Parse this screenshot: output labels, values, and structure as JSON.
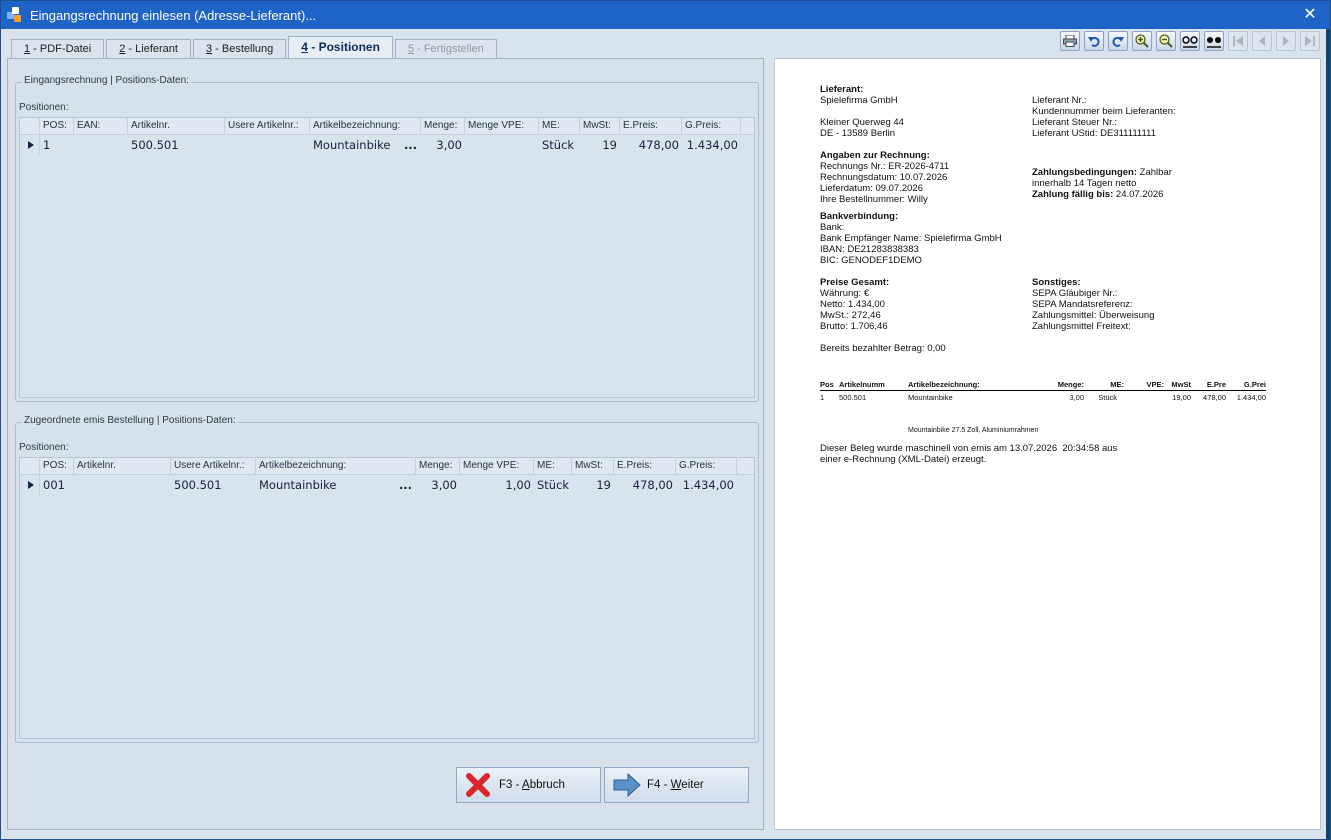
{
  "window": {
    "title": "Eingangsrechnung einlesen (Adresse-Lieferant)...",
    "close_glyph": "✕"
  },
  "tabs": [
    {
      "num": "1",
      "label": " - PDF-Datei"
    },
    {
      "num": "2",
      "label": " - Lieferant"
    },
    {
      "num": "3",
      "label": " - Bestellung"
    },
    {
      "num": "4",
      "label": " - Positionen"
    },
    {
      "num": "5",
      "label": " - Fertigstellen"
    }
  ],
  "toolbar": {
    "icons": [
      "printer-icon",
      "undo-icon",
      "redo-icon",
      "zoom-in-icon",
      "zoom-out-icon",
      "fit-width-icon",
      "fit-page-icon",
      "first-page-icon",
      "prev-page-icon",
      "next-page-icon",
      "last-page-icon"
    ]
  },
  "invoice_group": {
    "legend": "Eingangsrechnung | Positions-Daten:",
    "sublabel": "Positionen:",
    "headers": [
      "POS:",
      "EAN:",
      "Artikelnr.",
      "Usere Artikelnr.:",
      "Artikelbezeichnung:",
      "Menge:",
      "Menge VPE:",
      "ME:",
      "MwSt:",
      "E.Preis:",
      "G.Preis:"
    ],
    "rows": [
      {
        "pos": "1",
        "ean": "",
        "artikelnr": "500.501",
        "user_artikelnr": "",
        "bezeichnung": "Mountainbike",
        "dots": "...",
        "menge": "3,00",
        "menge_vpe": "",
        "me": "Stück",
        "mwst": "19",
        "epreis": "478,00",
        "gpreis": "1.434,00"
      }
    ]
  },
  "order_group": {
    "legend": "Zugeordnete emis Bestellung | Positions-Daten:",
    "sublabel": "Positionen:",
    "headers": [
      "POS:",
      "Artikelnr.",
      "Usere Artikelnr.:",
      "Artikelbezeichnung:",
      "Menge:",
      "Menge VPE:",
      "ME:",
      "MwSt:",
      "E.Preis:",
      "G.Preis:"
    ],
    "rows": [
      {
        "pos": "001",
        "artikelnr": "",
        "user_artikelnr": "500.501",
        "bezeichnung": "Mountainbike",
        "dots": "...",
        "menge": "3,00",
        "menge_vpe": "1,00",
        "me": "Stück",
        "mwst": "19",
        "epreis": "478,00",
        "gpreis": "1.434,00"
      }
    ]
  },
  "buttons": {
    "cancel_prefix": "F3 - ",
    "cancel_hot": "A",
    "cancel_rest": "bbruch",
    "next_prefix": "F4 - ",
    "next_hot": "W",
    "next_rest": "eiter"
  },
  "preview": {
    "lieferant_h": "Lieferant:",
    "lieferant_name": "Spielefirma GmbH",
    "street": "Kleiner Querweg 44",
    "city": "DE - 13589 Berlin",
    "lief_nr": "Lieferant Nr.:",
    "kundennr": "Kundennummer beim Lieferanten:",
    "steuer_nr": "Lieferant Steuer Nr.:",
    "ustid": "Lieferant UStid: DE311111111",
    "angaben_h": "Angaben zur Rechnung:",
    "rechnungsnr": "Rechnungs Nr.: ER-2026-4711",
    "rechnungsdatum": "Rechnungsdatum: 10.07.2026",
    "lieferdatum": "Lieferdatum: 09.07.2026",
    "bestellnr": "Ihre Bestellnummer: Willy",
    "zahl_h": "Zahlungsbedingungen:",
    "zahl_v1": " Zahlbar",
    "zahl_v2": "innerhalb 14 Tagen netto",
    "faellig_h": "Zahlung fällig bis:",
    "faellig_v": " 24.07.2026",
    "bank_h": "Bankverbindung:",
    "bank": "Bank:",
    "empf": "Bank Empfänger Name: Spielefirma GmbH",
    "iban": "IBAN: DE21283838383",
    "bic": "BIC: GENODEF1DEMO",
    "preise_h": "Preise Gesamt:",
    "waehrung": "Währung: €",
    "netto": "Netto: 1.434,00",
    "mwst": "MwSt.: 272,46",
    "brutto": "Brutto: 1.706,46",
    "sonst_h": "Sonstiges:",
    "sepa_glaeubiger": "SEPA Gläubiger Nr.:",
    "sepa_mandat": "SEPA Mandatsreferenz:",
    "zahlungsmittel": "Zahlungsmittel: Überweisung",
    "zahlungsmittel_frei": "Zahlungsmittel Freitext:",
    "bezahlt": "Bereits bezahlter Betrag: 0,00",
    "table_headers": [
      "Pos",
      "Artikelnumm",
      "Artikelbezeichnung:",
      "Menge:",
      "ME:",
      "VPE:",
      "MwSt",
      "E.Pre",
      "G.Prei"
    ],
    "table_row": [
      "1",
      "500.501",
      "Mountainbike",
      "3,00",
      "Stück",
      "",
      "19,00",
      "478,00",
      "1.434,00"
    ],
    "item_note": "Mountainbike 27.5 Zoll, Aluminiumrahmen",
    "footer1": "Dieser Beleg wurde maschinell von emis am 13.07.2026  20:34:58 aus",
    "footer2": "einer e-Rechnung (XML-Datei) erzeugt."
  }
}
